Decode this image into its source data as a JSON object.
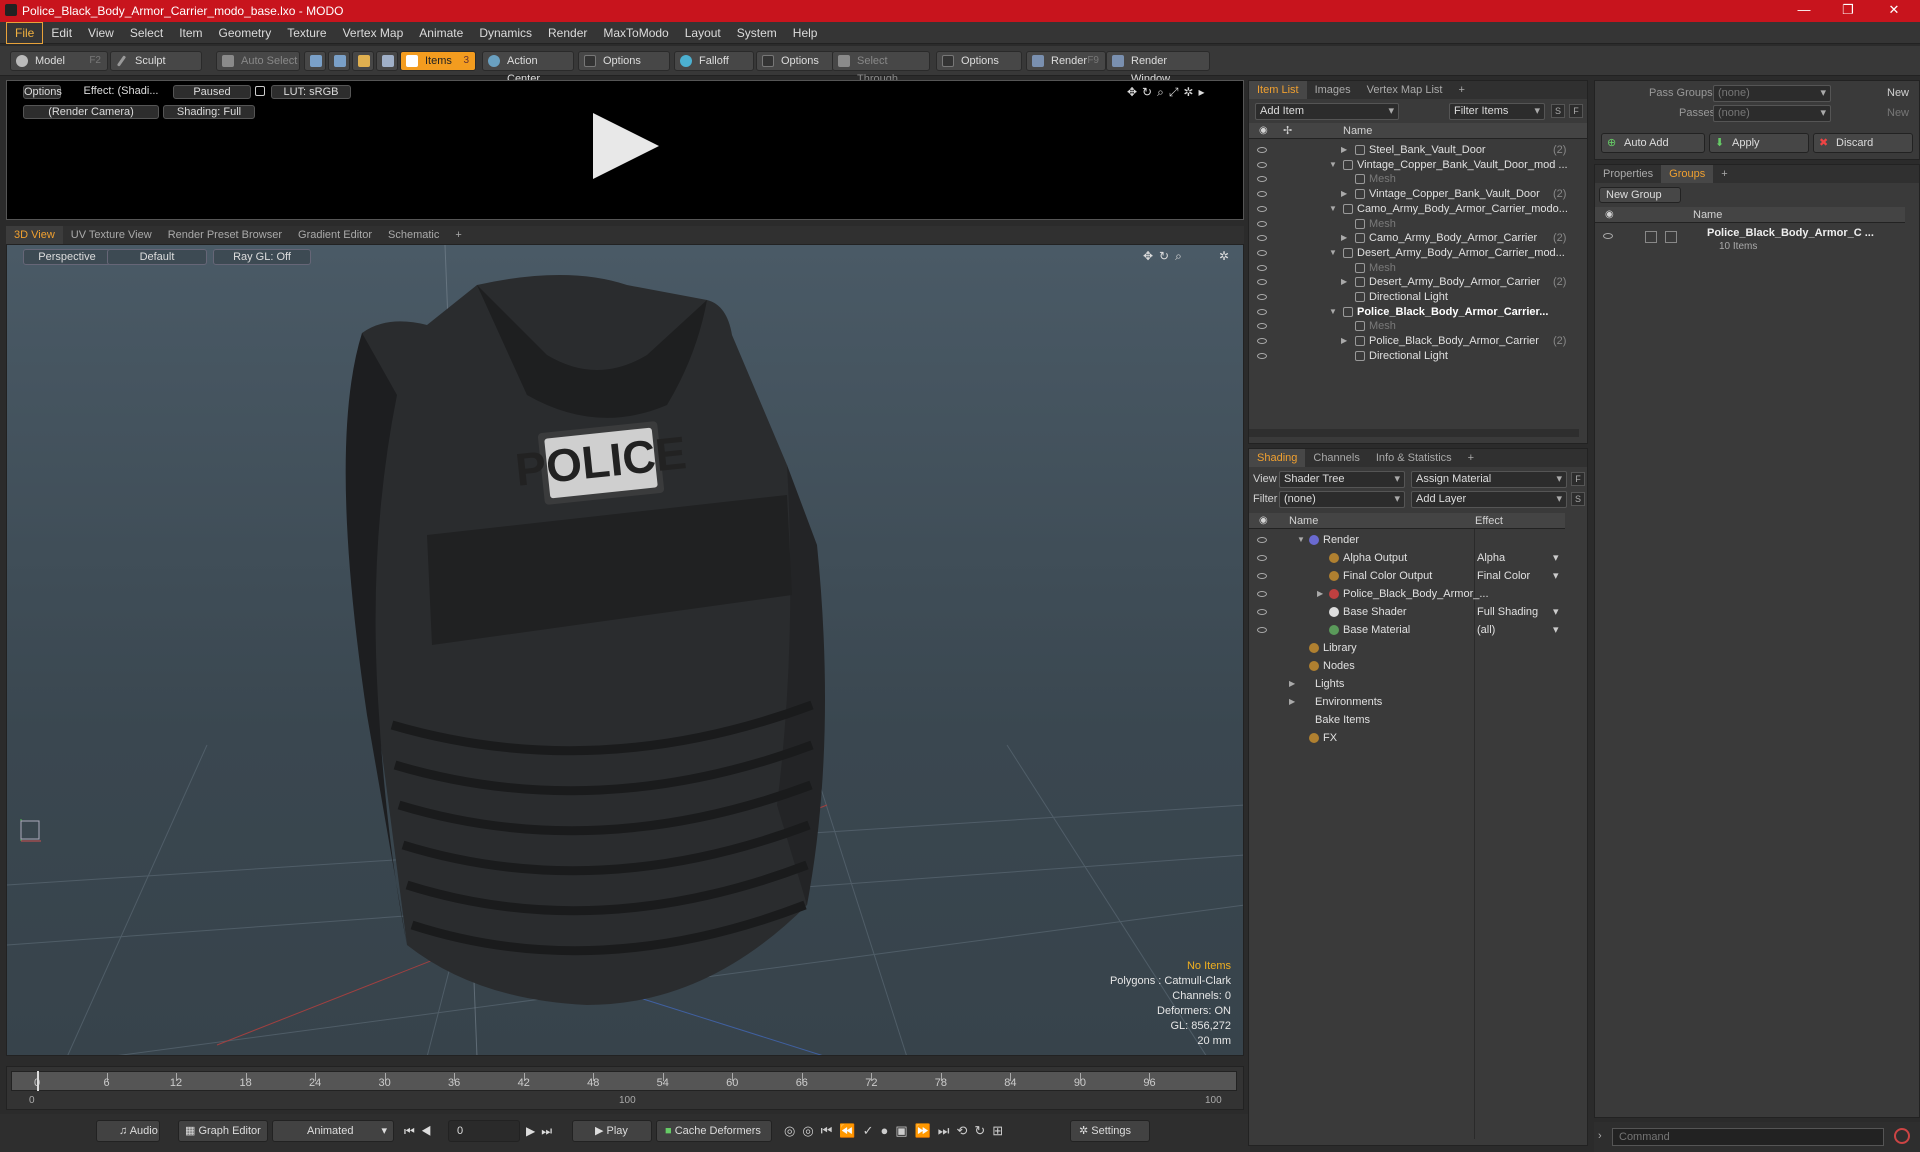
{
  "window": {
    "title": "Police_Black_Body_Armor_Carrier_modo_base.lxo - MODO",
    "minimize": "—",
    "maximize": "❐",
    "close": "✕"
  },
  "menu": [
    "File",
    "Edit",
    "View",
    "Select",
    "Item",
    "Geometry",
    "Texture",
    "Vertex Map",
    "Animate",
    "Dynamics",
    "Render",
    "MaxToModo",
    "Layout",
    "System",
    "Help"
  ],
  "toolbar": {
    "model": "Model",
    "model_key": "F2",
    "sculpt": "Sculpt",
    "auto_select": "Auto Select",
    "items": "Items",
    "items_key": "3",
    "action_center": "Action Center",
    "options1": "Options",
    "falloff": "Falloff",
    "options2": "Options",
    "select_through": "Select Through",
    "options3": "Options",
    "render": "Render",
    "render_key": "F9",
    "render_window": "Render Window"
  },
  "preview": {
    "options": "Options",
    "effect": "Effect: (Shadi...",
    "paused": "Paused",
    "lut": "LUT: sRGB",
    "camera": "(Render Camera)",
    "shading": "Shading: Full"
  },
  "viewport_tabs": [
    "3D View",
    "UV Texture View",
    "Render Preset Browser",
    "Gradient Editor",
    "Schematic",
    "+"
  ],
  "viewport": {
    "perspective": "Perspective",
    "default": "Default",
    "raygl": "Ray GL: Off",
    "vest_label": "POLICE",
    "stats": {
      "no_items": "No Items",
      "polygons": "Polygons : Catmull-Clark",
      "channels": "Channels: 0",
      "deformers": "Deformers: ON",
      "gl": "GL: 856,272",
      "units": "20 mm"
    }
  },
  "timeline": {
    "ticks": [
      "0",
      "6",
      "12",
      "18",
      "24",
      "30",
      "36",
      "42",
      "48",
      "54",
      "60",
      "66",
      "72",
      "78",
      "84",
      "90",
      "96"
    ],
    "start": "0",
    "mid": "100",
    "end": "100"
  },
  "transport": {
    "audio": "Audio",
    "graph_editor": "Graph Editor",
    "animated": "Animated",
    "frame": "0",
    "play": "Play",
    "cache": "Cache Deformers",
    "settings": "Settings"
  },
  "item_list": {
    "tabs": [
      "Item List",
      "Images",
      "Vertex Map List",
      "+"
    ],
    "add_item": "Add Item",
    "filter_items": "Filter Items",
    "col_name": "Name",
    "rows": [
      {
        "label": "Steel_Bank_Vault_Door",
        "count": "(2)",
        "indent": 2,
        "kind": "group"
      },
      {
        "label": "Vintage_Copper_Bank_Vault_Door_mod ...",
        "count": "",
        "indent": 1,
        "kind": "scene"
      },
      {
        "label": "Mesh",
        "count": "",
        "indent": 2,
        "kind": "mesh"
      },
      {
        "label": "Vintage_Copper_Bank_Vault_Door",
        "count": "(2)",
        "indent": 2,
        "kind": "group"
      },
      {
        "label": "Camo_Army_Body_Armor_Carrier_modo...",
        "count": "",
        "indent": 1,
        "kind": "scene"
      },
      {
        "label": "Mesh",
        "count": "",
        "indent": 2,
        "kind": "mesh"
      },
      {
        "label": "Camo_Army_Body_Armor_Carrier",
        "count": "(2)",
        "indent": 2,
        "kind": "group"
      },
      {
        "label": "Desert_Army_Body_Armor_Carrier_mod...",
        "count": "",
        "indent": 1,
        "kind": "scene"
      },
      {
        "label": "Mesh",
        "count": "",
        "indent": 2,
        "kind": "mesh"
      },
      {
        "label": "Desert_Army_Body_Armor_Carrier",
        "count": "(2)",
        "indent": 2,
        "kind": "group"
      },
      {
        "label": "Directional Light",
        "count": "",
        "indent": 2,
        "kind": "light"
      },
      {
        "label": "Police_Black_Body_Armor_Carrier...",
        "count": "",
        "indent": 1,
        "kind": "scene-bold"
      },
      {
        "label": "Mesh",
        "count": "",
        "indent": 2,
        "kind": "mesh"
      },
      {
        "label": "Police_Black_Body_Armor_Carrier",
        "count": "(2)",
        "indent": 2,
        "kind": "group"
      },
      {
        "label": "Directional Light",
        "count": "",
        "indent": 2,
        "kind": "light"
      }
    ]
  },
  "shading": {
    "tabs": [
      "Shading",
      "Channels",
      "Info & Statistics",
      "+"
    ],
    "view_label": "View",
    "view_value": "Shader Tree",
    "assign_material": "Assign Material",
    "filter_label": "Filter",
    "filter_value": "(none)",
    "add_layer": "Add Layer",
    "col_name": "Name",
    "col_effect": "Effect",
    "rows": [
      {
        "label": "Render",
        "effect": "",
        "indent": 0
      },
      {
        "label": "Alpha Output",
        "effect": "Alpha",
        "indent": 1
      },
      {
        "label": "Final Color Output",
        "effect": "Final Color",
        "indent": 1
      },
      {
        "label": "Police_Black_Body_Armor_...",
        "effect": "",
        "indent": 1
      },
      {
        "label": "Base Shader",
        "effect": "Full Shading",
        "indent": 1
      },
      {
        "label": "Base Material",
        "effect": "(all)",
        "indent": 1
      },
      {
        "label": "Library",
        "effect": "",
        "indent": 0
      },
      {
        "label": "Nodes",
        "effect": "",
        "indent": 0
      },
      {
        "label": "Lights",
        "effect": "",
        "indent": -1
      },
      {
        "label": "Environments",
        "effect": "",
        "indent": -1
      },
      {
        "label": "Bake Items",
        "effect": "",
        "indent": -1
      },
      {
        "label": "FX",
        "effect": "",
        "indent": 0
      }
    ]
  },
  "passes": {
    "pass_groups": "Pass Groups",
    "passes": "Passes",
    "none": "(none)",
    "new": "New",
    "auto_add": "Auto Add",
    "apply": "Apply",
    "discard": "Discard"
  },
  "groups": {
    "tabs": [
      "Properties",
      "Groups",
      "+"
    ],
    "new_group": "New Group",
    "col_name": "Name",
    "item": "Police_Black_Body_Armor_C ...",
    "item_count": "10 Items"
  },
  "command": {
    "placeholder": "Command"
  },
  "colors": {
    "title_bar": "#c8141d",
    "accent": "#f39c1f"
  }
}
